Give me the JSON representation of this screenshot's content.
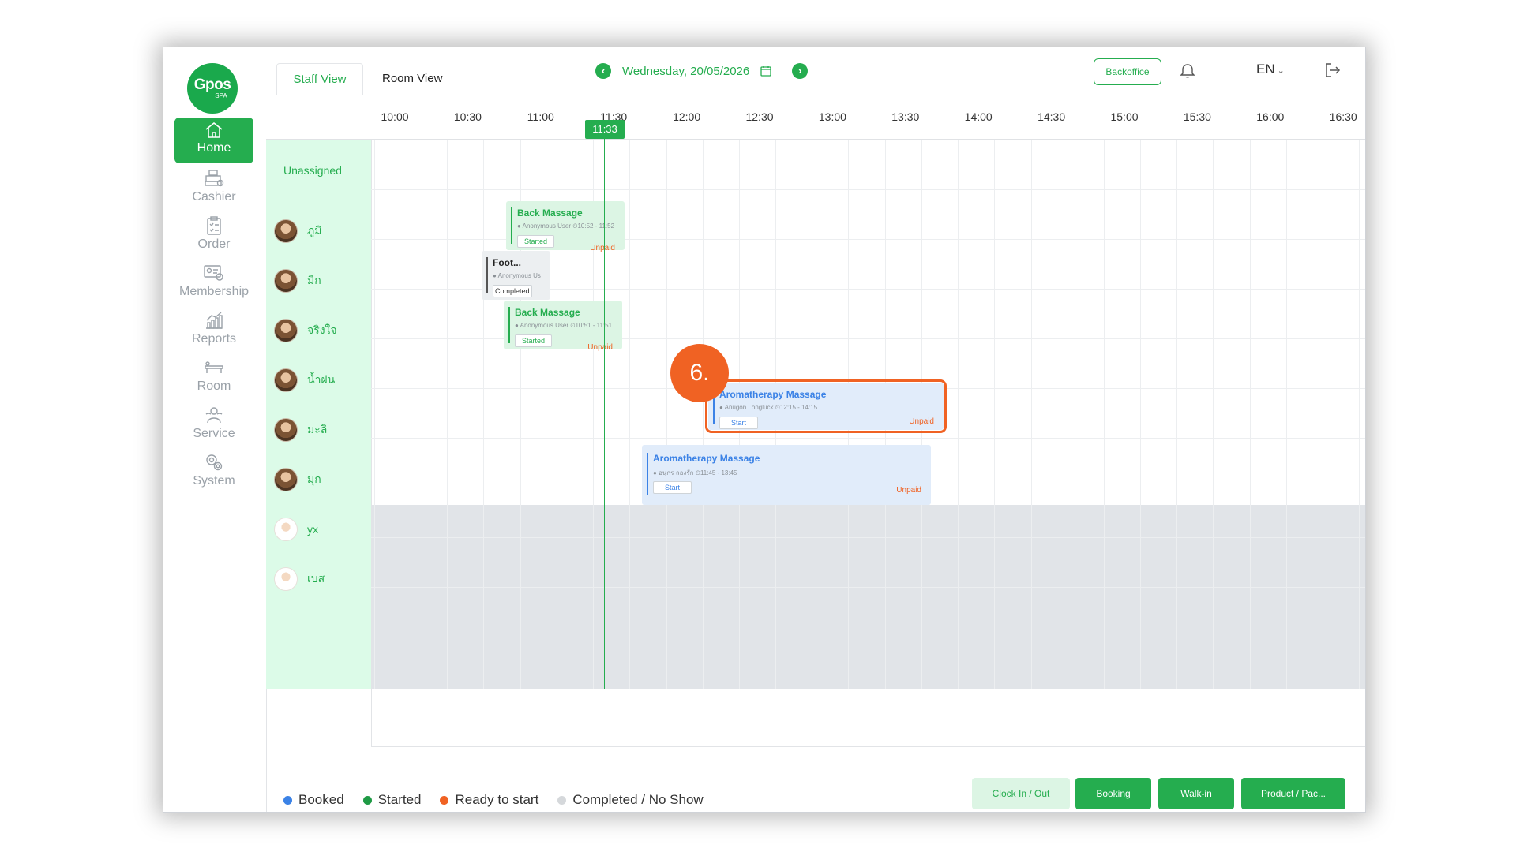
{
  "brand": {
    "logo_main": "Gpos",
    "logo_sub": "SPA"
  },
  "sidebar": {
    "items": [
      {
        "label": "Home",
        "icon": "home-icon",
        "active": true
      },
      {
        "label": "Cashier",
        "icon": "cashier-icon"
      },
      {
        "label": "Order",
        "icon": "order-icon"
      },
      {
        "label": "Membership",
        "icon": "membership-icon"
      },
      {
        "label": "Reports",
        "icon": "reports-icon"
      },
      {
        "label": "Room",
        "icon": "room-icon"
      },
      {
        "label": "Service",
        "icon": "service-icon"
      },
      {
        "label": "System",
        "icon": "system-icon"
      }
    ]
  },
  "header": {
    "tabs": [
      {
        "label": "Staff View",
        "active": true
      },
      {
        "label": "Room View"
      }
    ],
    "date": "Wednesday, 20/05/2026",
    "backoffice_label": "Backoffice",
    "language": "EN"
  },
  "timeline": {
    "times": [
      "10:00",
      "10:30",
      "11:00",
      "11:30",
      "12:00",
      "12:30",
      "13:00",
      "13:30",
      "14:00",
      "14:30",
      "15:00",
      "15:30",
      "16:00",
      "16:30"
    ],
    "now": "11:33"
  },
  "staff": {
    "unassigned": "Unassigned",
    "rows": [
      {
        "name": "ภูมิ"
      },
      {
        "name": "มิก"
      },
      {
        "name": "จริงใจ"
      },
      {
        "name": "น้ำฝน"
      },
      {
        "name": "มะลิ"
      },
      {
        "name": "มุก"
      },
      {
        "name": "yx"
      },
      {
        "name": "เบส"
      }
    ]
  },
  "bookings": [
    {
      "title": "Back Massage",
      "customer": "Anonymous User",
      "time": "10:52 - 11:52",
      "status": "Started",
      "payment": "Unpaid"
    },
    {
      "title": "Foot...",
      "customer": "Anonymous Us",
      "status": "Completed"
    },
    {
      "title": "Back Massage",
      "customer": "Anonymous User",
      "time": "10:51 - 11:51",
      "status": "Started",
      "payment": "Unpaid"
    },
    {
      "title": "Aromatherapy Massage",
      "customer": "Anugon Longluck",
      "time": "12:15 - 14:15",
      "status": "Start",
      "payment": "Unpaid"
    },
    {
      "title": "Aromatherapy Massage",
      "customer": "อนุกร ลองรัก",
      "time": "11:45 - 13:45",
      "status": "Start",
      "payment": "Unpaid"
    }
  ],
  "annotation": {
    "step": "6."
  },
  "legend": [
    {
      "label": "Booked",
      "color": "#3b82e6"
    },
    {
      "label": "Started",
      "color": "#1f9a45"
    },
    {
      "label": "Ready to start",
      "color": "#f06223"
    },
    {
      "label": "Completed / No Show",
      "color": "#d5d8db"
    }
  ],
  "footer": {
    "clock_label": "Clock In / Out",
    "booking_label": "Booking",
    "walkin_label": "Walk-in",
    "product_label": "Product / Pac..."
  },
  "colors": {
    "accent": "#25ad4f",
    "warning": "#f06223",
    "booked": "#3b82e6"
  }
}
